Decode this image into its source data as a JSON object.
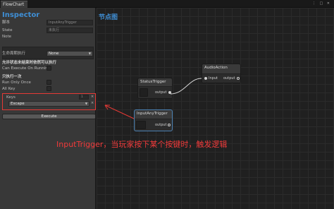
{
  "window": {
    "tab_label": "FlowChart",
    "controls_label": "⋮ □ ✕"
  },
  "inspector": {
    "title": "Inspector",
    "name_label": "脚本",
    "name_value": "InputAnyTrigger",
    "state_label": "State",
    "state_value": "未执行",
    "note_label": "Note",
    "lifecycle_label": "生命周期执行",
    "lifecycle_value": "None",
    "allow_exec_label": "允许状态未结束时依然可以执行",
    "can_exec_label": "Can Execute On Running",
    "run_once_cn_label": "只执行一次",
    "run_once_label": "Run Only Once",
    "all_key_label": "All Key",
    "keys_label": "Keys",
    "keys_count": "1",
    "key_value": "Escape",
    "execute_label": "Execute"
  },
  "graph": {
    "title": "节点图",
    "nodes": {
      "audio": {
        "title": "AudioAction",
        "input": "Input",
        "output": "output"
      },
      "status": {
        "title": "StatusTrigger",
        "output": "output"
      },
      "inputany": {
        "title": "InputAnyTrigger",
        "output": "output"
      }
    }
  },
  "annotation": "InputTrigger，当玩家按下某个按键时，触发逻辑",
  "colors": {
    "accent": "#3f8fd6",
    "highlight": "#e53935",
    "selection": "#4a7fb0"
  }
}
